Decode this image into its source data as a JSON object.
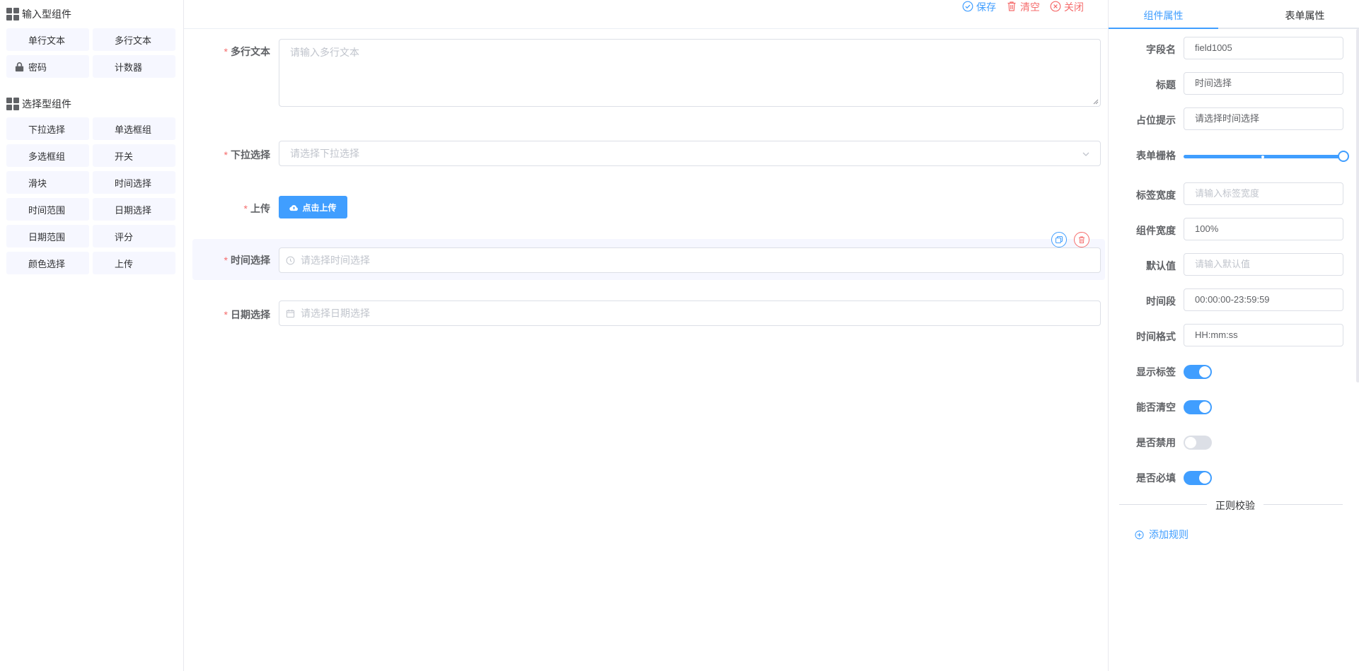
{
  "toolbar": {
    "save_label": "保存",
    "clear_label": "清空",
    "close_label": "关闭"
  },
  "left_panel": {
    "input_group_title": "输入型组件",
    "input_components": [
      {
        "label": "单行文本",
        "icon": null
      },
      {
        "label": "多行文本",
        "icon": null
      },
      {
        "label": "密码",
        "icon": "lock-icon"
      },
      {
        "label": "计数器",
        "icon": null
      }
    ],
    "select_group_title": "选择型组件",
    "select_components": [
      {
        "label": "下拉选择"
      },
      {
        "label": "单选框组"
      },
      {
        "label": "多选框组"
      },
      {
        "label": "开关"
      },
      {
        "label": "滑块"
      },
      {
        "label": "时间选择"
      },
      {
        "label": "时间范围"
      },
      {
        "label": "日期选择"
      },
      {
        "label": "日期范围"
      },
      {
        "label": "评分"
      },
      {
        "label": "颜色选择"
      },
      {
        "label": "上传"
      }
    ]
  },
  "canvas": {
    "fields": [
      {
        "label": "多行文本",
        "required": "*",
        "placeholder": "请输入多行文本",
        "type": "textarea"
      },
      {
        "label": "下拉选择",
        "required": "*",
        "placeholder": "请选择下拉选择",
        "type": "select"
      },
      {
        "label": "上传",
        "required": "*",
        "button_label": "点击上传",
        "type": "upload"
      },
      {
        "label": "时间选择",
        "required": "*",
        "placeholder": "请选择时间选择",
        "type": "time",
        "selected": true
      },
      {
        "label": "日期选择",
        "required": "*",
        "placeholder": "请选择日期选择",
        "type": "date"
      }
    ]
  },
  "right_panel": {
    "tabs": [
      {
        "label": "组件属性",
        "active": true
      },
      {
        "label": "表单属性",
        "active": false
      }
    ],
    "props": {
      "field_name": {
        "label": "字段名",
        "value": "field1005"
      },
      "title": {
        "label": "标题",
        "value": "时间选择"
      },
      "placeholder": {
        "label": "占位提示",
        "value": "请选择时间选择"
      },
      "span": {
        "label": "表单栅格",
        "value_fraction": 1.0
      },
      "label_width": {
        "label": "标签宽度",
        "placeholder": "请输入标签宽度"
      },
      "component_width": {
        "label": "组件宽度",
        "value": "100%"
      },
      "default_value": {
        "label": "默认值",
        "placeholder": "请输入默认值"
      },
      "time_range": {
        "label": "时间段",
        "value": "00:00:00-23:59:59"
      },
      "time_format": {
        "label": "时间格式",
        "value": "HH:mm:ss"
      },
      "show_label": {
        "label": "显示标签",
        "on": true
      },
      "clearable": {
        "label": "能否清空",
        "on": true
      },
      "disabled": {
        "label": "是否禁用",
        "on": false
      },
      "required": {
        "label": "是否必填",
        "on": true
      }
    },
    "regex_divider": "正则校验",
    "add_rule_label": "添加规则"
  },
  "colors": {
    "primary": "#409eff",
    "danger": "#f56c6c",
    "component_bg": "#f6f7ff",
    "switch_off": "#dcdfe6"
  }
}
